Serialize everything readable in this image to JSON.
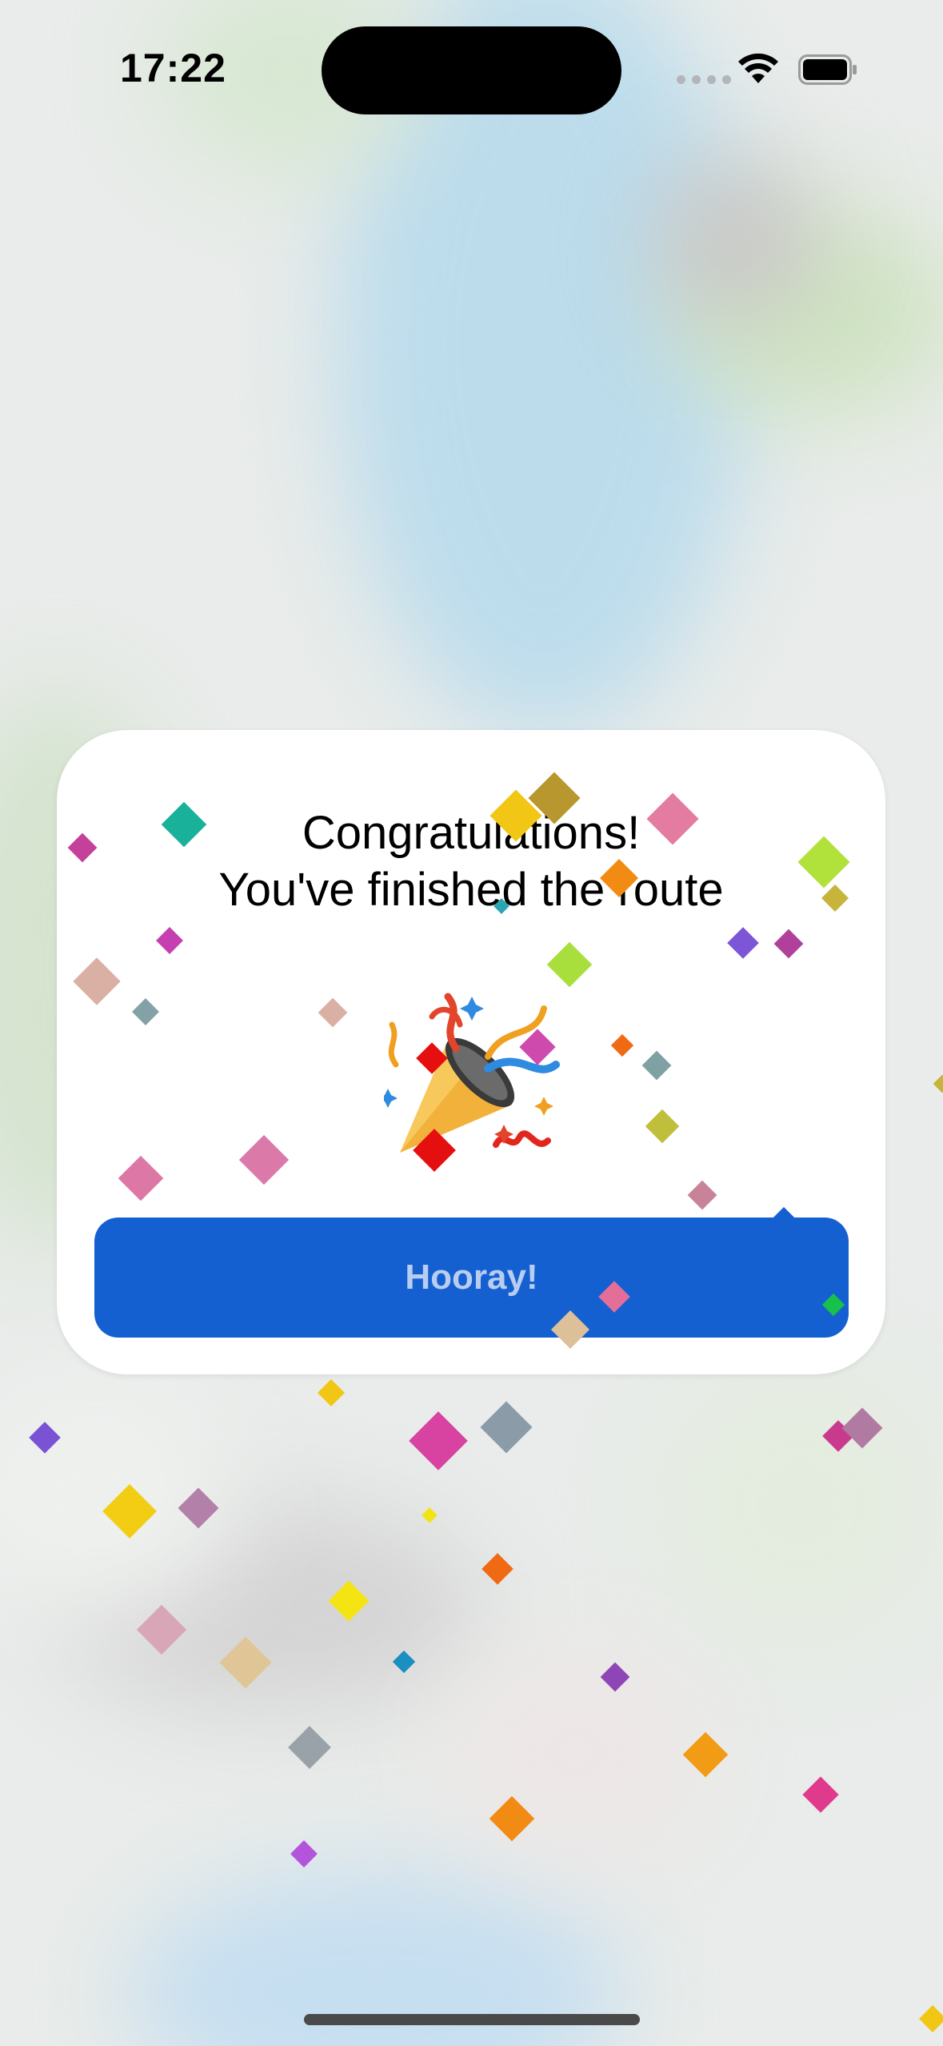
{
  "status_bar": {
    "time": "17:22"
  },
  "modal": {
    "title_line1": "Congratulations!",
    "title_line2": "You've finished the route",
    "emoji_icon": "party-popper-icon",
    "button_label": "Hooray!"
  },
  "colors": {
    "button_bg": "#1560d1",
    "button_text": "#b8cdf0",
    "card_bg": "#ffffff"
  }
}
